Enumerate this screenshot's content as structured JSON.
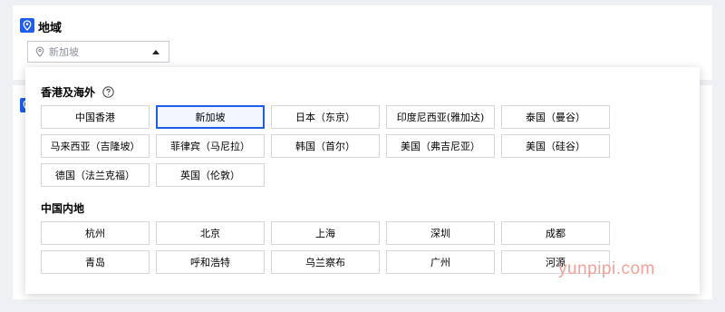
{
  "region": {
    "title": "地域",
    "selected_value": "新加坡"
  },
  "dropdown": {
    "groups": [
      {
        "title": "香港及海外",
        "options": [
          "中国香港",
          "新加坡",
          "日本（东京）",
          "印度尼西亚(雅加达)",
          "泰国（曼谷）",
          "马来西亚（吉隆坡）",
          "菲律宾（马尼拉）",
          "韩国（首尔）",
          "美国（弗吉尼亚）",
          "美国（硅谷）",
          "德国（法兰克福）",
          "英国（伦敦）"
        ]
      },
      {
        "title": "中国内地",
        "options": [
          "杭州",
          "北京",
          "上海",
          "深圳",
          "成都",
          "青岛",
          "呼和浩特",
          "乌兰察布",
          "广州",
          "河源"
        ]
      }
    ],
    "selected_option": "新加坡"
  },
  "watermark": "yunpipi.com",
  "colors": {
    "accent": "#1f5eea",
    "option_border": "#d3d6da",
    "selected_bg": "#f2f6fe",
    "watermark": "#f0a29b"
  },
  "icons": {
    "section": "location-pin-icon",
    "select_prefix": "location-pin-icon",
    "select_suffix": "caret-up-icon",
    "help": "question-circle-icon"
  }
}
